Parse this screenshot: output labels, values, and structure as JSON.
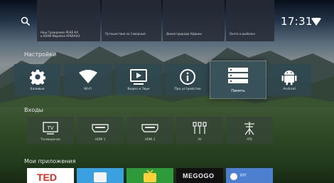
{
  "topbar": {
    "time": "17:31",
    "thumbs": [
      {
        "line1": "Наш Гражданин РЕНЕ КА",
        "line2": "и КЕНИ Мирэйне КРЕКАНЭ"
      },
      {
        "line1": "Путешествия на Северный",
        "line2": ""
      },
      {
        "line1": "Дикая природа Африки",
        "line2": ""
      },
      {
        "line1": "Охота и рыбалка",
        "line2": ""
      }
    ]
  },
  "settings": {
    "title": "Настройки",
    "tiles": [
      {
        "label": "Базовые",
        "icon": "gear-icon"
      },
      {
        "label": "Wi-Fi",
        "icon": "wifi-icon"
      },
      {
        "label": "Видео и Звук",
        "icon": "video-sound-icon"
      },
      {
        "label": "Про устройство",
        "icon": "info-icon"
      },
      {
        "label": "Память",
        "icon": "storage-icon",
        "selected": true
      },
      {
        "label": "Android",
        "icon": "android-icon"
      }
    ]
  },
  "inputs": {
    "title": "Входы",
    "items": [
      {
        "label": "Телевидение",
        "icon": "tv-icon"
      },
      {
        "label": "HDMI 1",
        "icon": "hdmi-icon"
      },
      {
        "label": "HDMI 2",
        "icon": "hdmi-icon"
      },
      {
        "label": "AV",
        "icon": "av-icon"
      },
      {
        "label": "ATB",
        "icon": "antenna-icon"
      }
    ]
  },
  "apps": {
    "title": "Мои приложения",
    "items": [
      {
        "label": "TED",
        "icon": "ted-logo",
        "color": "#e62b1e"
      },
      {
        "label": "",
        "icon": "blue-app-icon",
        "color": "#3aa0e0"
      },
      {
        "label": "",
        "icon": "tv-app-icon",
        "color": "#2f9a3a"
      },
      {
        "label": "MEGOGO",
        "icon": "megogo-logo",
        "color": "#111111"
      },
      {
        "label": "MY",
        "icon": "video-app-icon",
        "color": "#4d7fd0"
      }
    ]
  }
}
